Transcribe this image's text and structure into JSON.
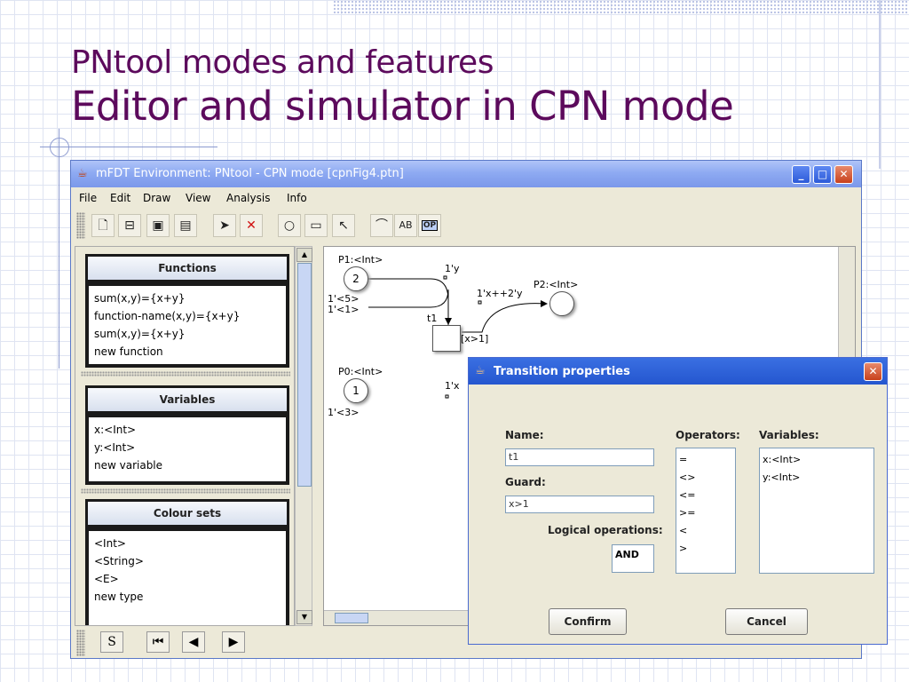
{
  "slide": {
    "title_line1": "PNtool modes and features",
    "title_line2": "Editor and simulator in CPN mode"
  },
  "window": {
    "title": "mFDT Environment: PNtool - CPN mode [cpnFig4.ptn]",
    "menu": [
      "File",
      "Edit",
      "Draw",
      "View",
      "Analysis",
      "Info"
    ]
  },
  "toolbar": {
    "icons": [
      "new-file-icon",
      "open-file-icon",
      "save-icon",
      "save-as-icon",
      "select-arrow-icon",
      "delete-icon",
      "place-tool-icon",
      "transition-tool-icon",
      "arc-tool-icon",
      "curve-tool-icon",
      "text-tool-icon",
      "operator-tool-icon"
    ],
    "text_tool_label": "AB",
    "op_tool_label": "OP"
  },
  "panels": {
    "functions": {
      "header": "Functions",
      "items": [
        "sum(x,y)={x+y}",
        "function-name(x,y)={x+y}",
        "sum(x,y)={x+y}",
        "new function"
      ]
    },
    "variables": {
      "header": "Variables",
      "items": [
        "x:<Int>",
        "y:<Int>",
        "new variable"
      ]
    },
    "colour_sets": {
      "header": "Colour sets",
      "items": [
        "<Int>",
        "<String>",
        "<E>",
        "new type"
      ]
    }
  },
  "canvas": {
    "p1_label": "P1:<Int>",
    "p1_tokens": "2",
    "p1_marking": [
      "1'<5>",
      "1'<1>"
    ],
    "p0_label": "P0:<Int>",
    "p0_tokens": "1",
    "p0_marking": "1'<3>",
    "p2_label": "P2:<Int>",
    "t1_label": "t1",
    "t1_guard": "[x>1]",
    "arc_p1_t1": "1'y",
    "arc_t1_p2": "1'x++2'y",
    "arc_p0_t1": "1'x"
  },
  "bottombar": {
    "s_button": "S"
  },
  "dialog": {
    "title": "Transition properties",
    "name_label": "Name:",
    "name_value": "t1",
    "guard_label": "Guard:",
    "guard_value": "x>1",
    "logical_label": "Logical operations:",
    "logical_value": "AND",
    "operators_label": "Operators:",
    "operators": [
      "=",
      "<>",
      "<=",
      ">=",
      "<",
      ">"
    ],
    "variables_label": "Variables:",
    "variables": [
      "x:<Int>",
      "y:<Int>"
    ],
    "confirm": "Confirm",
    "cancel": "Cancel"
  }
}
